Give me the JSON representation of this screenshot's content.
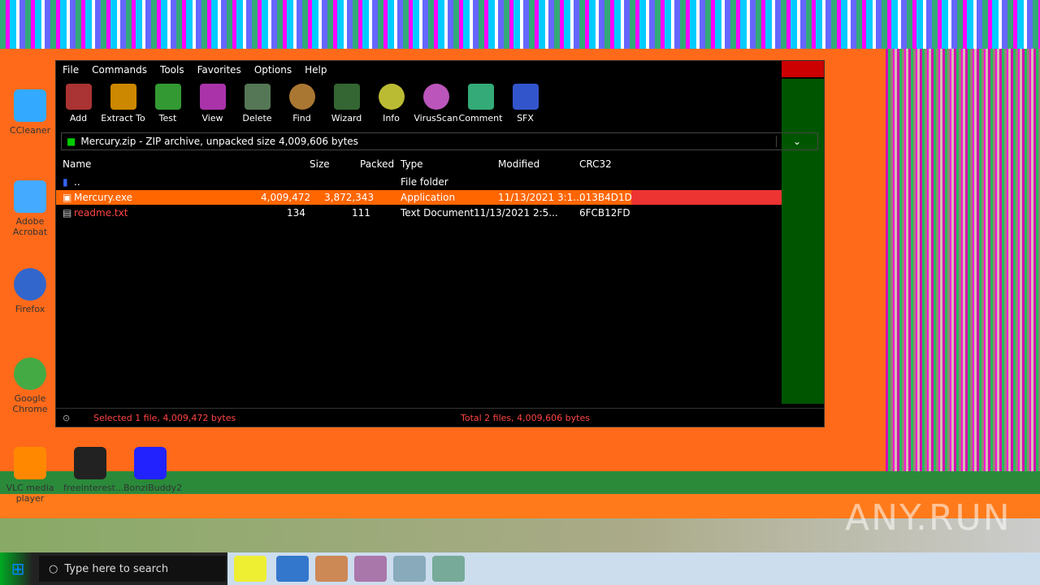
{
  "window": {
    "title": "Mercury.zip",
    "menu": [
      "File",
      "Commands",
      "Tools",
      "Favorites",
      "Options",
      "Help"
    ],
    "toolbar": [
      {
        "label": "Add",
        "icon": "books-icon"
      },
      {
        "label": "Extract To",
        "icon": "folder-extract-icon"
      },
      {
        "label": "Test",
        "icon": "test-clipboard-icon"
      },
      {
        "label": "View",
        "icon": "book-view-icon"
      },
      {
        "label": "Delete",
        "icon": "trash-icon"
      },
      {
        "label": "Find",
        "icon": "magnifier-icon"
      },
      {
        "label": "Wizard",
        "icon": "wand-icon"
      },
      {
        "label": "Info",
        "icon": "info-icon"
      },
      {
        "label": "VirusScan",
        "icon": "virus-scan-icon"
      },
      {
        "label": "Comment",
        "icon": "comment-icon"
      },
      {
        "label": "SFX",
        "icon": "sfx-icon"
      }
    ],
    "address": "Mercury.zip - ZIP archive, unpacked size 4,009,606 bytes",
    "columns": {
      "name": "Name",
      "size": "Size",
      "packed": "Packed",
      "type": "Type",
      "modified": "Modified",
      "crc": "CRC32"
    },
    "rows": [
      {
        "name": "..",
        "size": "",
        "packed": "",
        "type": "File folder",
        "modified": "",
        "crc": ""
      },
      {
        "name": "Mercury.exe",
        "size": "4,009,472",
        "packed": "3,872,343",
        "type": "Application",
        "modified": "11/13/2021 3:1...",
        "crc": "013B4D1D"
      },
      {
        "name": "readme.txt",
        "size": "134",
        "packed": "111",
        "type": "Text Document",
        "modified": "11/13/2021 2:5...",
        "crc": "6FCB12FD"
      }
    ],
    "status": {
      "left": "Selected 1 file, 4,009,472 bytes",
      "right": "Total 2 files, 4,009,606 bytes"
    }
  },
  "desktop": {
    "icons": [
      "CCleaner",
      "Adobe Acrobat",
      "Firefox",
      "Google Chrome",
      "VLC media player",
      "freeinterest...",
      "BonziBuddy2"
    ]
  },
  "taskbar": {
    "search_placeholder": "Type here to search"
  },
  "watermark": "ANY.RUN",
  "colors": {
    "window_bg": "#000000",
    "selection": "#ff6600",
    "accent_orange": "#ff6a1a",
    "status_text": "#ff4444"
  }
}
